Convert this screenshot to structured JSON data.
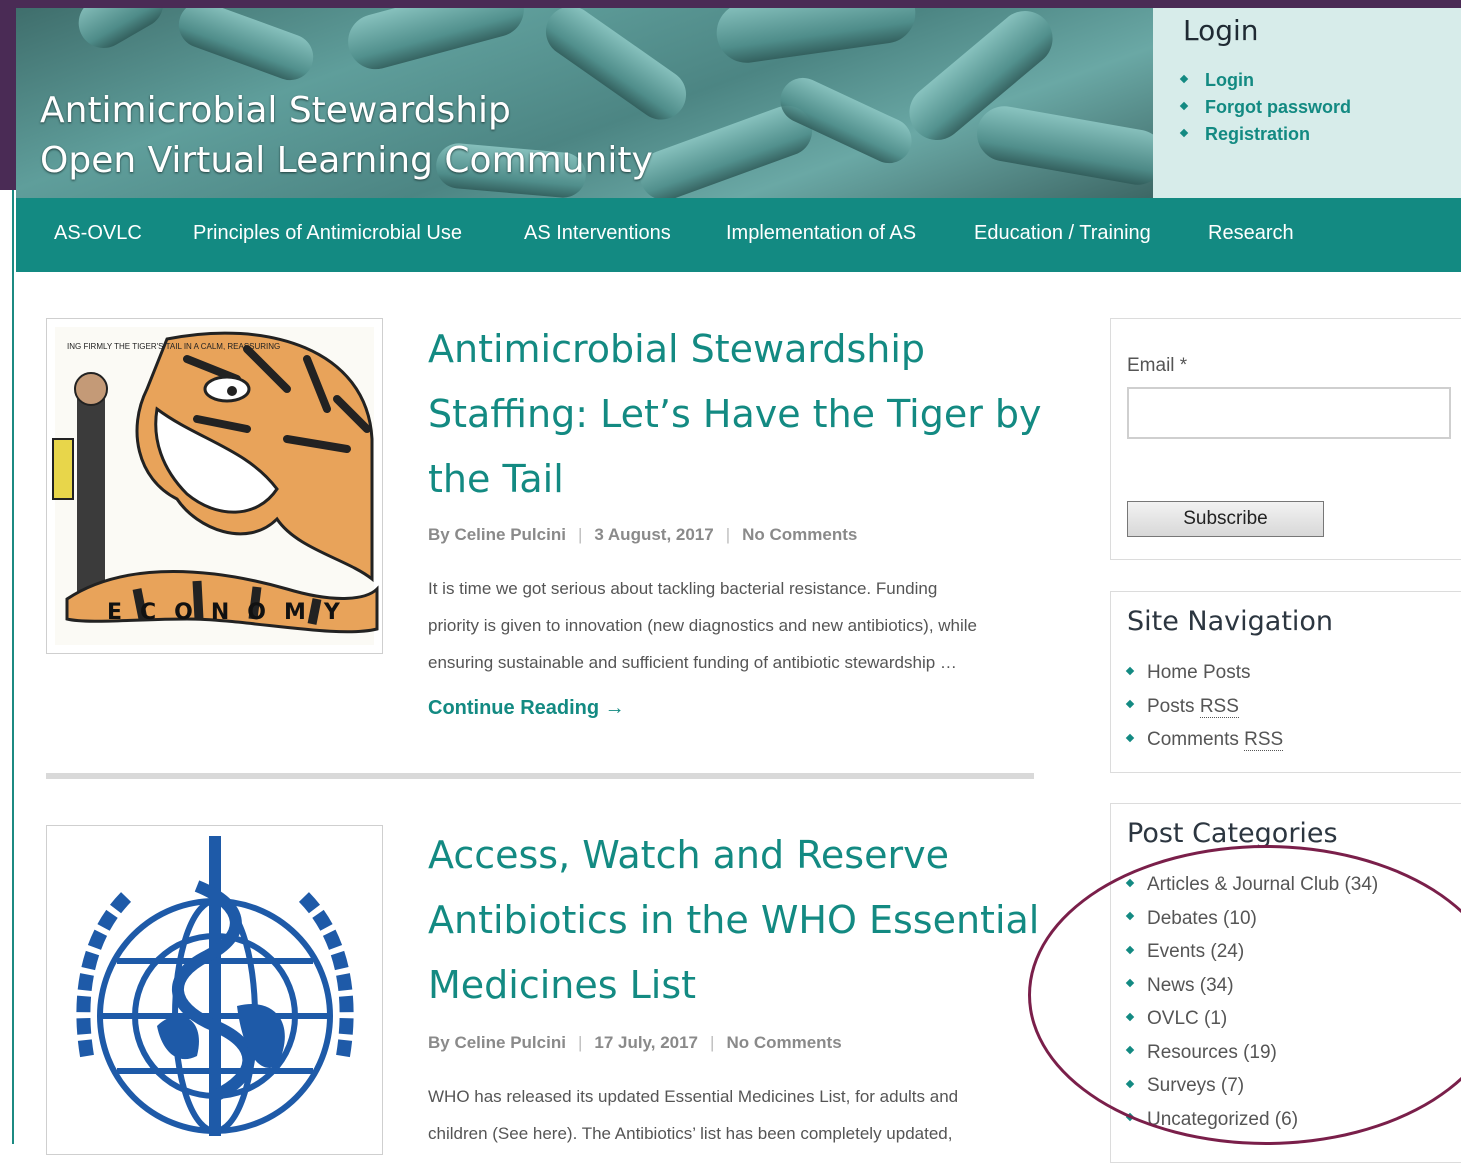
{
  "header": {
    "site_title_line1": "Antimicrobial Stewardship",
    "site_title_line2": "Open Virtual Learning Community"
  },
  "login": {
    "title": "Login",
    "links": [
      "Login",
      "Forgot password",
      "Registration"
    ]
  },
  "nav": {
    "items": [
      "AS-OVLC",
      "Principles of Antimicrobial Use",
      "AS Interventions",
      "Implementation of AS",
      "Education / Training",
      "Research"
    ]
  },
  "posts": [
    {
      "title_lines": [
        "Antimicrobial Stewardship",
        "Staffing: Let’s Have the Tiger by",
        "the Tail"
      ],
      "author": "By Celine Pulcini",
      "date": "3 August, 2017",
      "comments": "No Comments",
      "excerpt_lines": [
        "It is time we got serious about tackling bacterial resistance. Funding",
        "priority is given to innovation (new diagnostics and new antibiotics), while",
        "ensuring sustainable and sufficient funding of antibiotic stewardship …"
      ],
      "more_label": "Continue Reading →",
      "cartoon_caption": "ING FIRMLY THE TIGER'S TAIL IN A CALM, REASSURING",
      "cartoon_word": "ECONOMY"
    },
    {
      "title_lines": [
        "Access, Watch and Reserve",
        "Antibiotics in the WHO Essential",
        "Medicines List"
      ],
      "author": "By Celine Pulcini",
      "date": "17 July, 2017",
      "comments": "No Comments",
      "excerpt_lines": [
        "WHO has released its updated Essential Medicines List, for adults and",
        "children (See here). The Antibiotics’ list has been completely updated,"
      ]
    }
  ],
  "subscribe_widget": {
    "email_label": "Email *",
    "email_value": "",
    "button_label": "Subscribe"
  },
  "site_navigation": {
    "title": "Site Navigation",
    "item1": "Home Posts",
    "item2_prefix": "Posts",
    "item3_prefix": "Comments",
    "rss": "RSS"
  },
  "post_categories": {
    "title": "Post Categories",
    "items": [
      "Articles & Journal Club (34)",
      "Debates (10)",
      "Events (24)",
      "News (34)",
      "OVLC (1)",
      "Resources (19)",
      "Surveys (7)",
      "Uncategorized (6)"
    ]
  },
  "colors": {
    "brand_teal": "#138a82",
    "frame_purple": "#4a2b55",
    "annotation_ellipse": "#7a1f4a"
  }
}
